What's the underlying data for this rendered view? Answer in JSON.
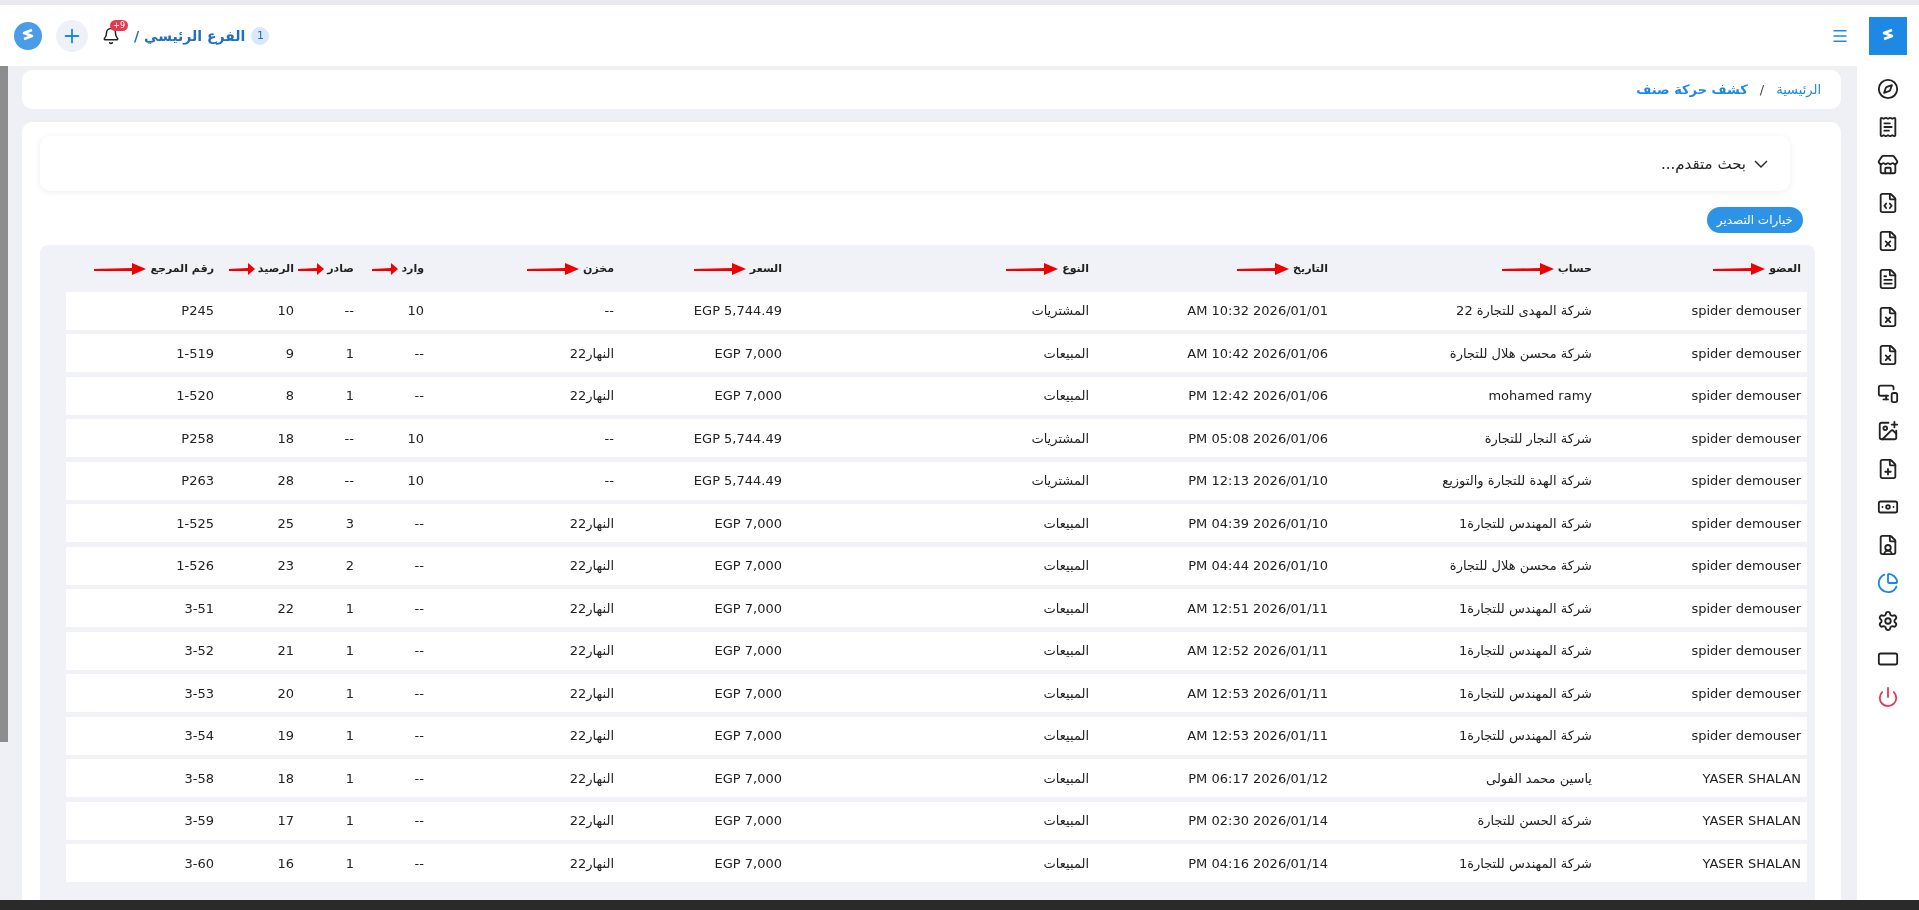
{
  "topbar": {
    "branch": "الفرع الرئيسي /",
    "branch_count": "1",
    "notifications": "+9"
  },
  "breadcrumb_separator": "/",
  "breadcrumb": [
    {
      "label": "الرئيسية",
      "current": false
    },
    {
      "label": "كشف حركة صنف",
      "current": true
    }
  ],
  "advanced_search": {
    "label": "بحث متقدم...",
    "expanded": false
  },
  "export_button": "خيارات التصدير",
  "table": {
    "columns": [
      {
        "label": "العضو",
        "marked": true
      },
      {
        "label": "حساب",
        "marked": true
      },
      {
        "label": "التاريخ",
        "marked": true
      },
      {
        "label": "النوع",
        "marked": true
      },
      {
        "label": "السعر",
        "marked": true
      },
      {
        "label": "مخزن",
        "marked": true
      },
      {
        "label": "وارد",
        "marked": true
      },
      {
        "label": "صادر",
        "marked": true
      },
      {
        "label": "الرصيد",
        "marked": true
      },
      {
        "label": "رقم المرجع",
        "marked": true
      }
    ],
    "rows": [
      [
        "spider demouser",
        "شركة المهدى للتجارة 22",
        "AM 10:32 2026/01/01",
        "المشتريات",
        "EGP 5,744.49",
        "--",
        "10",
        "--",
        "10",
        "P245"
      ],
      [
        "spider demouser",
        "شركة محسن هلال للتجارة",
        "AM 10:42 2026/01/06",
        "المبيعات",
        "EGP 7,000",
        "النهار22",
        "--",
        "1",
        "9",
        "1-519"
      ],
      [
        "spider demouser",
        "mohamed ramy",
        "PM 12:42 2026/01/06",
        "المبيعات",
        "EGP 7,000",
        "النهار22",
        "--",
        "1",
        "8",
        "1-520"
      ],
      [
        "spider demouser",
        "شركة النجار للتجارة",
        "PM 05:08 2026/01/06",
        "المشتريات",
        "EGP 5,744.49",
        "--",
        "10",
        "--",
        "18",
        "P258"
      ],
      [
        "spider demouser",
        "شركة الهدة للتجارة والتوزيع",
        "PM 12:13 2026/01/10",
        "المشتريات",
        "EGP 5,744.49",
        "--",
        "10",
        "--",
        "28",
        "P263"
      ],
      [
        "spider demouser",
        "شركة المهندس للتجارة1",
        "PM 04:39 2026/01/10",
        "المبيعات",
        "EGP 7,000",
        "النهار22",
        "--",
        "3",
        "25",
        "1-525"
      ],
      [
        "spider demouser",
        "شركة محسن هلال للتجارة",
        "PM 04:44 2026/01/10",
        "المبيعات",
        "EGP 7,000",
        "النهار22",
        "--",
        "2",
        "23",
        "1-526"
      ],
      [
        "spider demouser",
        "شركة المهندس للتجارة1",
        "AM 12:51 2026/01/11",
        "المبيعات",
        "EGP 7,000",
        "النهار22",
        "--",
        "1",
        "22",
        "3-51"
      ],
      [
        "spider demouser",
        "شركة المهندس للتجارة1",
        "AM 12:52 2026/01/11",
        "المبيعات",
        "EGP 7,000",
        "النهار22",
        "--",
        "1",
        "21",
        "3-52"
      ],
      [
        "spider demouser",
        "شركة المهندس للتجارة1",
        "AM 12:53 2026/01/11",
        "المبيعات",
        "EGP 7,000",
        "النهار22",
        "--",
        "1",
        "20",
        "3-53"
      ],
      [
        "spider demouser",
        "شركة المهندس للتجارة1",
        "AM 12:53 2026/01/11",
        "المبيعات",
        "EGP 7,000",
        "النهار22",
        "--",
        "1",
        "19",
        "3-54"
      ],
      [
        "YASER SHALAN",
        "ياسين محمد الفولى",
        "PM 06:17 2026/01/12",
        "المبيعات",
        "EGP 7,000",
        "النهار22",
        "--",
        "1",
        "18",
        "3-58"
      ],
      [
        "YASER SHALAN",
        "شركة الحسن للتجارة",
        "PM 02:30 2026/01/14",
        "المبيعات",
        "EGP 7,000",
        "النهار22",
        "--",
        "1",
        "17",
        "3-59"
      ],
      [
        "YASER SHALAN",
        "شركة المهندس للتجارة1",
        "PM 04:16 2026/01/14",
        "المبيعات",
        "EGP 7,000",
        "النهار22",
        "--",
        "1",
        "16",
        "3-60"
      ]
    ]
  },
  "sidebar": [
    {
      "selected": false
    },
    {
      "selected": false
    },
    {
      "selected": false
    },
    {
      "selected": false
    },
    {
      "selected": false
    },
    {
      "selected": false
    },
    {
      "selected": false
    },
    {
      "selected": false
    },
    {
      "selected": false
    },
    {
      "selected": false
    },
    {
      "selected": false
    },
    {
      "selected": false
    },
    {
      "selected": false
    },
    {
      "selected": true
    },
    {
      "selected": false
    },
    {
      "selected": false
    },
    {
      "selected": false
    }
  ]
}
